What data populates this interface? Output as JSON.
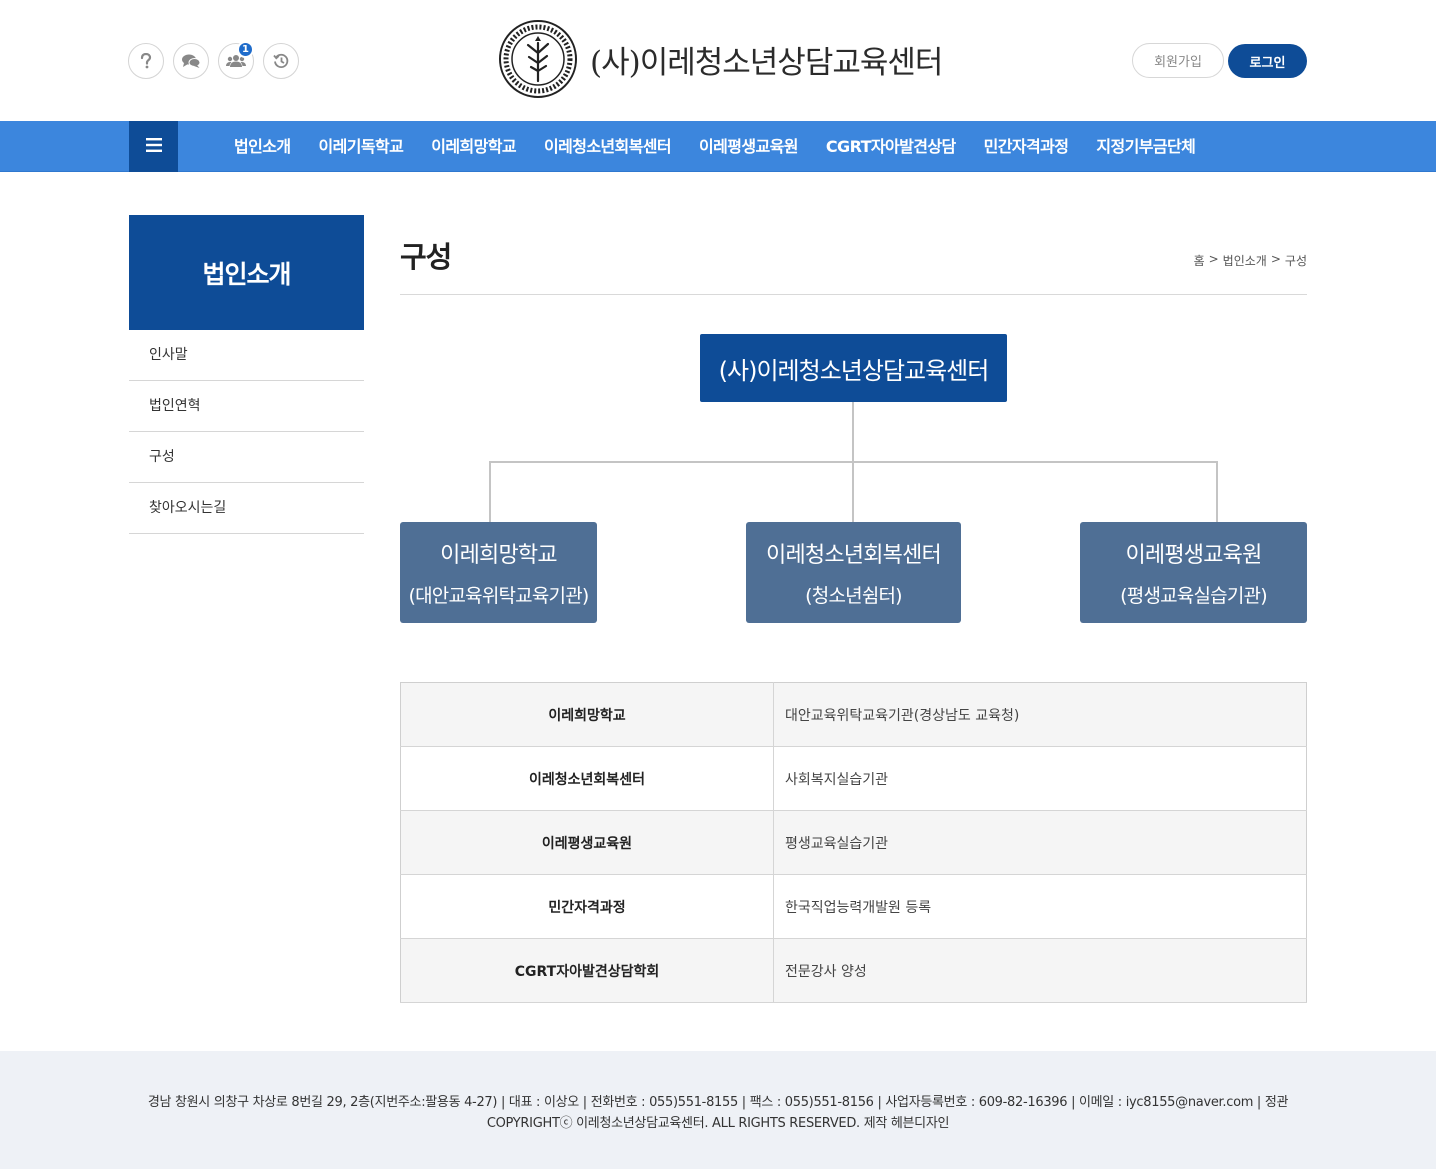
{
  "header": {
    "logo_text": "(사)이레청소년상담교육센터",
    "notification_count": "1",
    "join_label": "회원가입",
    "login_label": "로그인",
    "icons": [
      "help-icon",
      "chat-icon",
      "users-icon",
      "history-icon"
    ]
  },
  "nav": {
    "items": [
      {
        "label": "법인소개"
      },
      {
        "label": "이레기독학교"
      },
      {
        "label": "이레희망학교"
      },
      {
        "label": "이레청소년회복센터"
      },
      {
        "label": "이레평생교육원"
      },
      {
        "label": "CGRT자아발견상담"
      },
      {
        "label": "민간자격과정"
      },
      {
        "label": "지정기부금단체"
      }
    ]
  },
  "sidebar": {
    "title": "법인소개",
    "items": [
      {
        "label": "인사말"
      },
      {
        "label": "법인연혁"
      },
      {
        "label": "구성"
      },
      {
        "label": "찾아오시는길"
      }
    ]
  },
  "page": {
    "title": "구성",
    "breadcrumb": [
      "홈",
      "법인소개",
      "구성"
    ],
    "breadcrumb_sep": ">"
  },
  "org_chart": {
    "root": "(사)이레청소년상담교육센터",
    "children": [
      {
        "name": "이레희망학교",
        "sub": "(대안교육위탁교육기관)"
      },
      {
        "name": "이레청소년회복센터",
        "sub": "(청소년쉼터)"
      },
      {
        "name": "이레평생교육원",
        "sub": "(평생교육실습기관)"
      }
    ]
  },
  "table": {
    "rows": [
      {
        "key": "이레희망학교",
        "value": "대안교육위탁교육기관(경상남도 교육청)"
      },
      {
        "key": "이레청소년회복센터",
        "value": "사회복지실습기관"
      },
      {
        "key": "이레평생교육원",
        "value": "평생교육실습기관"
      },
      {
        "key": "민간자격과정",
        "value": "한국직업능력개발원 등록"
      },
      {
        "key": "CGRT자아발견상담학회",
        "value": "전문강사 양성"
      }
    ]
  },
  "footer": {
    "line1": "경남 창원시 의창구 차상로 8번길 29, 2층(지번주소:팔용동 4-27) | 대표 : 이상오 | 전화번호 : 055)551-8155 | 팩스 : 055)551-8156 | 사업자등록번호 : 609-82-16396 | 이메일 : iyc8155@naver.com | 정관",
    "line2": "COPYRIGHTⓒ 이레청소년상담교육센터. ALL RIGHTS RESERVED. 제작 헤븐디자인"
  },
  "colors": {
    "primary_dark": "#0e4c97",
    "nav_blue": "#3c86dd",
    "org_child": "#4f6f95",
    "footer_bg": "#eef1f6"
  }
}
